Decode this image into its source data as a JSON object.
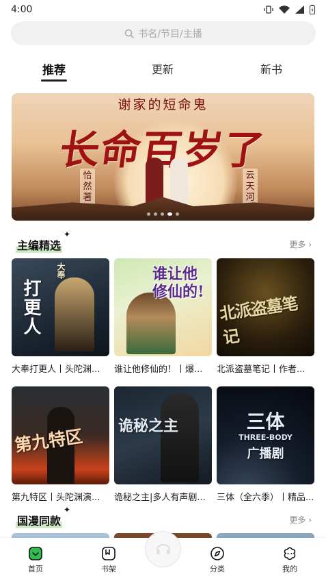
{
  "status": {
    "time": "4:00"
  },
  "search": {
    "placeholder": "书名/节目/主播"
  },
  "tabs": [
    {
      "label": "推荐",
      "active": true
    },
    {
      "label": "更新",
      "active": false
    },
    {
      "label": "新书",
      "active": false
    }
  ],
  "banner": {
    "top_text": "谢家的短命鬼",
    "title": "长命百岁了",
    "left_seal": "恰然著",
    "right_seal": "云天河制",
    "slide_count": 5,
    "active_slide": 4
  },
  "sections": [
    {
      "title": "主编精选",
      "more": "更多 ›",
      "books": [
        {
          "title": "大奉打更人丨头陀渊...",
          "cover_text": "打更人",
          "cover_badge": "大奉"
        },
        {
          "title": "谁让他修仙的！丨爆...",
          "cover_text": "谁让他修仙的!"
        },
        {
          "title": "北派盗墓笔记丨作者...",
          "cover_text": "北派盗墓笔记"
        },
        {
          "title": "第九特区丨头陀渊演...",
          "cover_text": "第九特区"
        },
        {
          "title": "诡秘之主|多人有声剧...",
          "cover_text": "诡秘之主"
        },
        {
          "title": "三体（全六季）丨精品...",
          "cover_text": "三体",
          "cover_sub": "THREE-BODY",
          "cover_sub2": "广播剧"
        }
      ]
    },
    {
      "title": "国漫同款",
      "more": "更多 ›"
    }
  ],
  "bottom_nav": [
    {
      "label": "首页",
      "icon": "home-icon",
      "active": true
    },
    {
      "label": "书架",
      "icon": "bookshelf-icon"
    },
    {
      "label": "分类",
      "icon": "compass-icon"
    },
    {
      "label": "我的",
      "icon": "profile-icon"
    }
  ],
  "colors": {
    "accent": "#2ebd4e",
    "highlight": "#cde9c3"
  }
}
